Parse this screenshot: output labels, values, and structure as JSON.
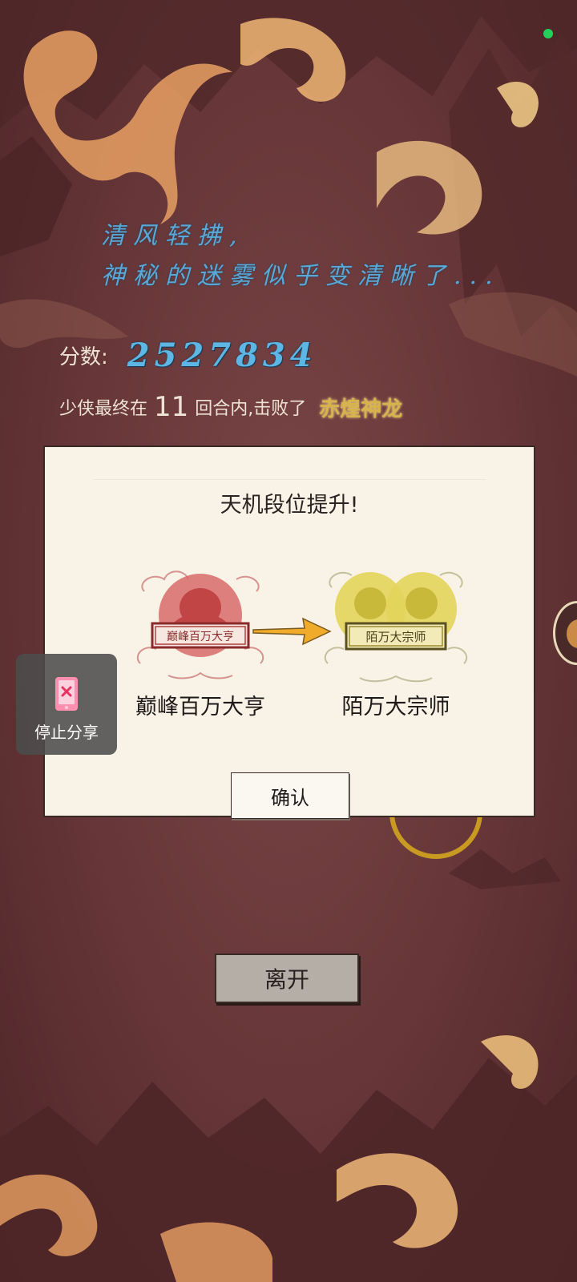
{
  "poem": {
    "line1": "清风轻拂,",
    "line2": "神秘的迷雾似乎变清晰了..."
  },
  "score": {
    "label": "分数:",
    "value": "2527834"
  },
  "result": {
    "prefix": "少侠最终在",
    "rounds": "11",
    "middle": "回合内,击败了",
    "boss": "赤煌神龙"
  },
  "dialog": {
    "title": "天机段位提升!",
    "old_rank": {
      "name": "巅峰百万大亨",
      "plaque_text": "巅峰百万大亨",
      "color": "#c94a4a"
    },
    "new_rank": {
      "name": "陌万大宗师",
      "plaque_text": "陌万大宗师",
      "color": "#d9c23d"
    },
    "confirm_label": "确认"
  },
  "leave_label": "离开",
  "share": {
    "label": "停止分享",
    "icon": "phone-stop-icon"
  },
  "colors": {
    "background": "#6e3a3b",
    "poem_text": "#5aa8d6",
    "boss_text": "#d8b24b",
    "dialog_bg": "#f8f3e6",
    "status_dot": "#22d05a"
  }
}
